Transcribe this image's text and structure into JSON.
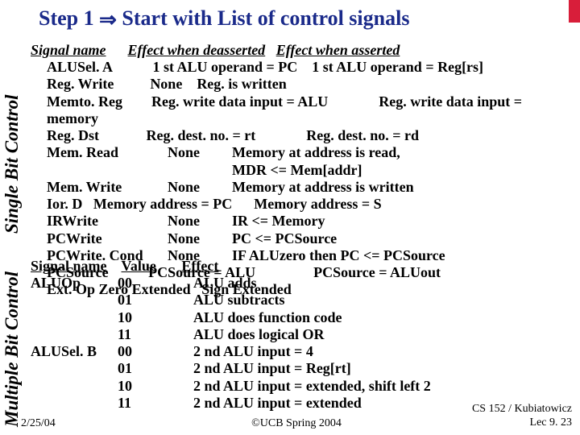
{
  "title_a": "Step 1",
  "title_b": "Start with List of control signals",
  "side_label_1": "Single Bit Control",
  "side_label_2": "Multiple Bit Control",
  "block1": {
    "h_sig": "Signal name",
    "h_de": "Effect when deasserted",
    "h_as": "Effect when asserted",
    "r1_s": "ALUSel. A",
    "r1_d": "1 st ALU operand = PC",
    "r1_a": "1 st ALU operand = Reg[rs]",
    "r2_s": "Reg. Write",
    "r2_d": "None",
    "r2_a": "Reg. is written",
    "r3_s": "Memto. Reg",
    "r3_d": "Reg. write data input = ALU",
    "r3_a": "Reg. write data input = memory",
    "r4_s": "Reg. Dst",
    "r4_d": "Reg. dest. no. =  rt",
    "r4_a": "Reg. dest. no. =  rd",
    "r5_s": "Mem. Read",
    "r5_d": "None",
    "r5_a": "Memory at address is read,",
    "r5_a2": "MDR <= Mem[addr]",
    "r6_s": "Mem. Write",
    "r6_d": "None",
    "r6_a": "Memory at address is written",
    "r7_s": "Ior. D",
    "r7_d": "Memory address = PC",
    "r7_a": "Memory address = S",
    "r8_s": "IRWrite",
    "r8_d": "None",
    "r8_a": "IR <= Memory",
    "r9_s": "PCWrite",
    "r9_d": "None",
    "r9_a": "PC <= PCSource",
    "r10_s": "PCWrite. Cond",
    "r10_d": "None",
    "r10_a": "IF ALUzero then PC <= PCSource",
    "r11_s": "PCSource",
    "r11_d": "PCSource = ALU",
    "r11_a": "PCSource = ALUout",
    "r12_s": "Ext. Op",
    "r12_d": "Zero Extended",
    "r12_a": "Sign Extended"
  },
  "block2": {
    "h_sig": "Signal name",
    "h_val": "Value",
    "h_eff": "Effect",
    "r1_s": "ALUOp",
    "r1_v": "00",
    "r1_e": "ALU adds",
    "r2_v": "01",
    "r2_e": "ALU subtracts",
    "r3_v": "10",
    "r3_e": "ALU does function code",
    "r4_v": "11",
    "r4_e": "ALU does logical OR",
    "r5_s": "ALUSel. B",
    "r5_v": "00",
    "r5_e": "2 nd ALU input = 4",
    "r6_v": "01",
    "r6_e": "2 nd ALU input = Reg[rt]",
    "r7_v": "10",
    "r7_e": "2 nd ALU input = extended, shift left 2",
    "r8_v": "11",
    "r8_e": "2 nd ALU input = extended"
  },
  "footer": {
    "date": "2/25/04",
    "center": "©UCB Spring 2004",
    "right1": "CS 152 / Kubiatowicz",
    "right2": "Lec 9. 23"
  }
}
